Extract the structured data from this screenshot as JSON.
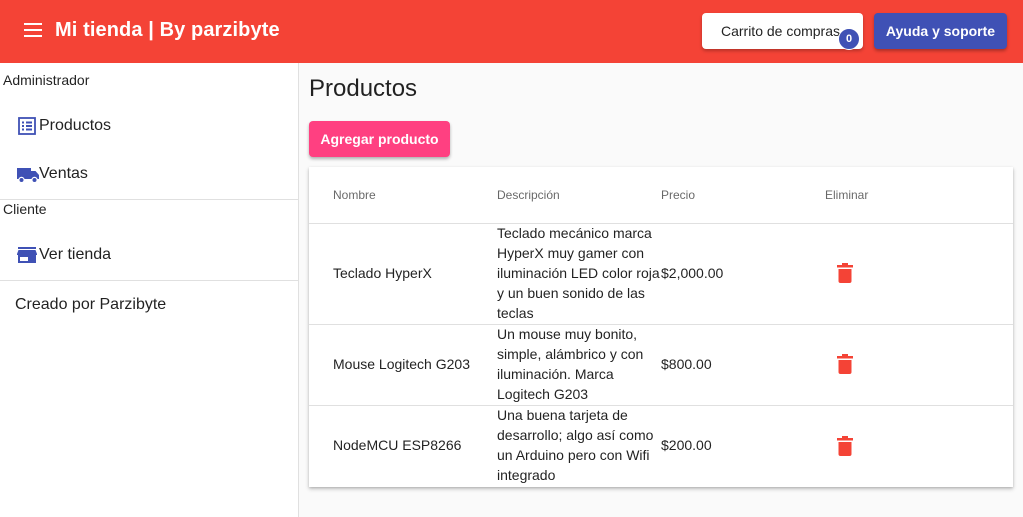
{
  "header": {
    "title": "Mi tienda | By parzibyte",
    "menu_icon": "menu-icon",
    "cart_label": "Carrito de compras",
    "cart_count": "0",
    "help_label": "Ayuda y soporte",
    "bar_color": "#f44336"
  },
  "sidebar": {
    "admin_header": "Administrador",
    "admin_items": [
      {
        "label": "Productos",
        "icon": "list-icon"
      },
      {
        "label": "Ventas",
        "icon": "truck-icon"
      }
    ],
    "client_header": "Cliente",
    "client_items": [
      {
        "label": "Ver tienda",
        "icon": "store-icon"
      }
    ],
    "credit": "Creado por Parzibyte"
  },
  "main": {
    "title": "Productos",
    "add_button": "Agregar producto",
    "table": {
      "columns": [
        "Nombre",
        "Descripción",
        "Precio",
        "Eliminar"
      ],
      "rows": [
        {
          "name": "Teclado HyperX",
          "description": "Teclado mecánico marca HyperX muy gamer con iluminación LED color roja y un buen sonido de las teclas",
          "price": "$2,000.00"
        },
        {
          "name": "Mouse Logitech G203",
          "description": "Un mouse muy bonito, simple, alámbrico y con iluminación. Marca Logitech G203",
          "price": "$800.00"
        },
        {
          "name": "NodeMCU ESP8266",
          "description": "Una buena tarjeta de desarrollo; algo así como un Arduino pero con Wifi integrado",
          "price": "$200.00"
        }
      ]
    }
  },
  "colors": {
    "primary": "#3f51b5",
    "accent": "#ff4081",
    "danger": "#f44336"
  }
}
